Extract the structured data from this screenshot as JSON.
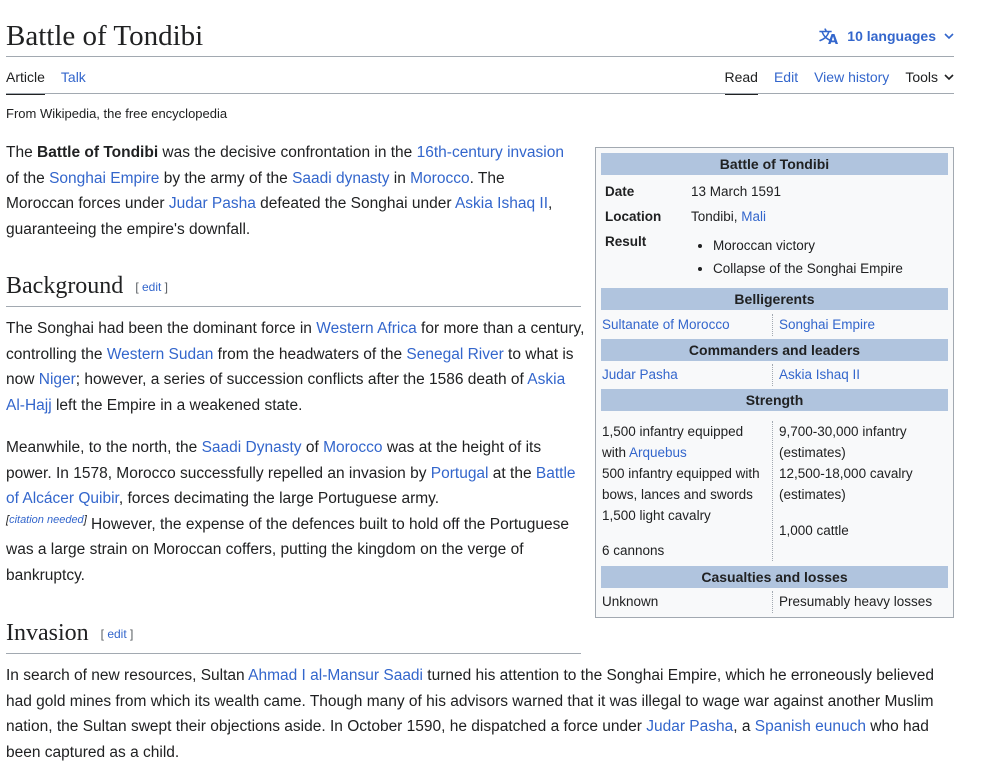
{
  "page": {
    "title": "Battle of Tondibi",
    "languages": "10 languages",
    "tagline": "From Wikipedia, the free encyclopedia"
  },
  "tabs": {
    "article": "Article",
    "talk": "Talk",
    "read": "Read",
    "edit": "Edit",
    "history": "View history",
    "tools": "Tools"
  },
  "intro": {
    "t1": "The ",
    "bold": "Battle of Tondibi",
    "t2": " was the decisive confrontation in the ",
    "l1": "16th-century invasion",
    "t3": " of the ",
    "l2": "Songhai Empire",
    "t4": " by the army of the ",
    "l3": "Saadi dynasty",
    "t5": " in ",
    "l4": "Morocco",
    "t6": ". The Moroccan forces under ",
    "l5": "Judar Pasha",
    "t7": " defeated the Songhai under ",
    "l6": "Askia Ishaq II",
    "t8": ", guaranteeing the empire's downfall."
  },
  "background": {
    "heading": "Background",
    "edit": "edit",
    "p1": {
      "t1": "The Songhai had been the dominant force in ",
      "l1": "Western Africa",
      "t2": " for more than a century, controlling the ",
      "l2": "Western Sudan",
      "t3": " from the headwaters of the ",
      "l3": "Senegal River",
      "t4": " to what is now ",
      "l4": "Niger",
      "t5": "; however, a series of succession conflicts after the 1586 death of ",
      "l5": "Askia Al-Hajj",
      "t6": " left the Empire in a weakened state."
    },
    "p2": {
      "t1": "Meanwhile, to the north, the ",
      "l1": "Saadi Dynasty",
      "t2": " of ",
      "l2": "Morocco",
      "t3": " was at the height of its power. In 1578, Morocco successfully repelled an invasion by ",
      "l3": "Portugal",
      "t4": " at the ",
      "l4": "Battle of Alcácer Quibir",
      "t5": ", forces decimating the large Portuguese army.",
      "cite": "citation needed",
      "t6": " However, the expense of the defences built to hold off the Portuguese was a large strain on Moroccan coffers, putting the kingdom on the verge of bankruptcy."
    }
  },
  "invasion": {
    "heading": "Invasion",
    "edit": "edit",
    "p1": {
      "t1": "In search of new resources, Sultan ",
      "l1": "Ahmad I al-Mansur Saadi",
      "t2": " turned his attention to the Songhai Empire, which he erroneously believed had gold mines from which its wealth came. Though many of his advisors warned that it was illegal to wage war against another Muslim nation, the Sultan swept their objections aside. In October 1590, he dispatched a force under ",
      "l2": "Judar Pasha",
      "t3": ", a ",
      "l3": "Spanish eunuch",
      "t4": " who had been captured as a child."
    }
  },
  "infobox": {
    "title": "Battle of Tondibi",
    "date_label": "Date",
    "date": "13 March 1591",
    "location_label": "Location",
    "location_place": "Tondibi, ",
    "location_link": "Mali",
    "result_label": "Result",
    "results": [
      "Moroccan victory",
      "Collapse of the Songhai Empire"
    ],
    "belligerents_head": "Belligerents",
    "bel_left": "Sultanate of Morocco",
    "bel_right": "Songhai Empire",
    "commanders_head": "Commanders and leaders",
    "cmd_left": "Judar Pasha",
    "cmd_right": "Askia Ishaq II",
    "strength_head": "Strength",
    "str_left_a": "1,500 infantry equipped",
    "str_left_b": "with ",
    "str_left_link": "Arquebus",
    "str_left_c": "500 infantry equipped with",
    "str_left_d": "bows, lances and swords",
    "str_left_e": "1,500 light cavalry",
    "str_left_f": "6 cannons",
    "str_right_a": "9,700-30,000 infantry",
    "str_right_b": "(estimates)",
    "str_right_c": "12,500-18,000 cavalry",
    "str_right_d": "(estimates)",
    "str_right_e": "1,000 cattle",
    "casualties_head": "Casualties and losses",
    "cas_left": "Unknown",
    "cas_right": "Presumably heavy losses"
  }
}
